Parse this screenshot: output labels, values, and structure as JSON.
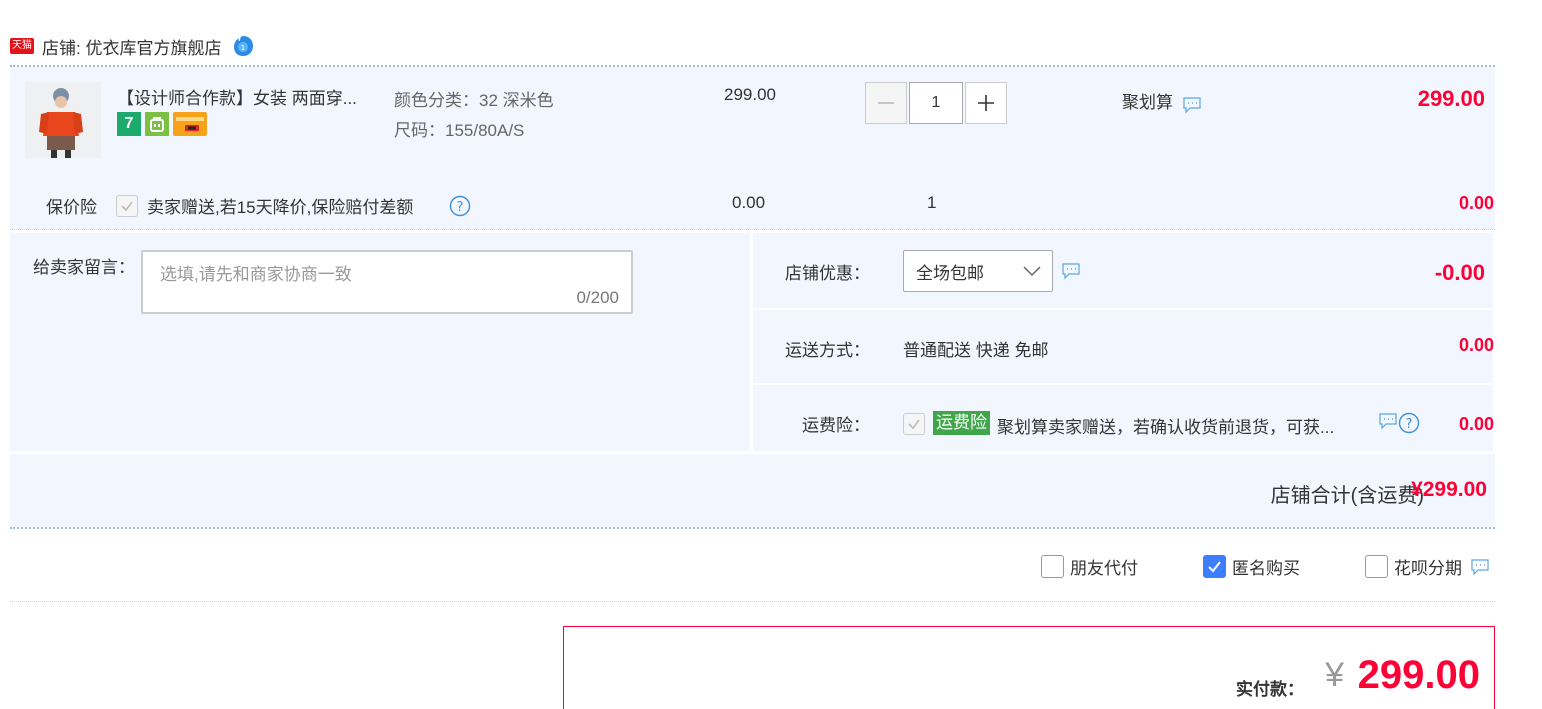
{
  "shop": {
    "badge": "天猫",
    "label": "店铺: 优衣库官方旗舰店"
  },
  "item": {
    "title": "【设计师合作款】女装 两面穿...",
    "sku_color": "颜色分类：32 深米色",
    "sku_size": "尺码：155/80A/S",
    "unit_price": "299.00",
    "quantity": "1",
    "promo": "聚划算",
    "subtotal": "299.00",
    "service_icons": [
      "7",
      "bag-icon",
      "card-icon"
    ]
  },
  "insurance": {
    "label": "保价险",
    "text": "卖家赠送,若15天降价,保险赔付差额",
    "price": "0.00",
    "quantity": "1",
    "total": "0.00"
  },
  "message": {
    "label": "给卖家留言：",
    "placeholder": "选填,请先和商家协商一致",
    "count": "0/200"
  },
  "coupon": {
    "label": "店铺优惠：",
    "selected": "全场包邮",
    "amount": "-0.00"
  },
  "shipping": {
    "label": "运送方式：",
    "text": "普通配送 快递 免邮",
    "amount": "0.00"
  },
  "freight_insurance": {
    "label": "运费险：",
    "badge": "运费险",
    "text": "聚划算卖家赠送，若确认收货前退货，可获...",
    "amount": "0.00"
  },
  "shop_total": {
    "label": "店铺合计(含运费)",
    "value": "¥299.00"
  },
  "pay_options": [
    {
      "label": "朋友代付",
      "checked": false
    },
    {
      "label": "匿名购买",
      "checked": true
    },
    {
      "label": "花呗分期",
      "checked": false
    }
  ],
  "final": {
    "label": "实付款：",
    "currency": "¥",
    "value": "299.00"
  },
  "colors": {
    "price_red": "#ff0036",
    "panel_bg": "#f2f7ff",
    "checkbox_blue": "#3d7eff",
    "badge_green": "#3fa64a"
  }
}
